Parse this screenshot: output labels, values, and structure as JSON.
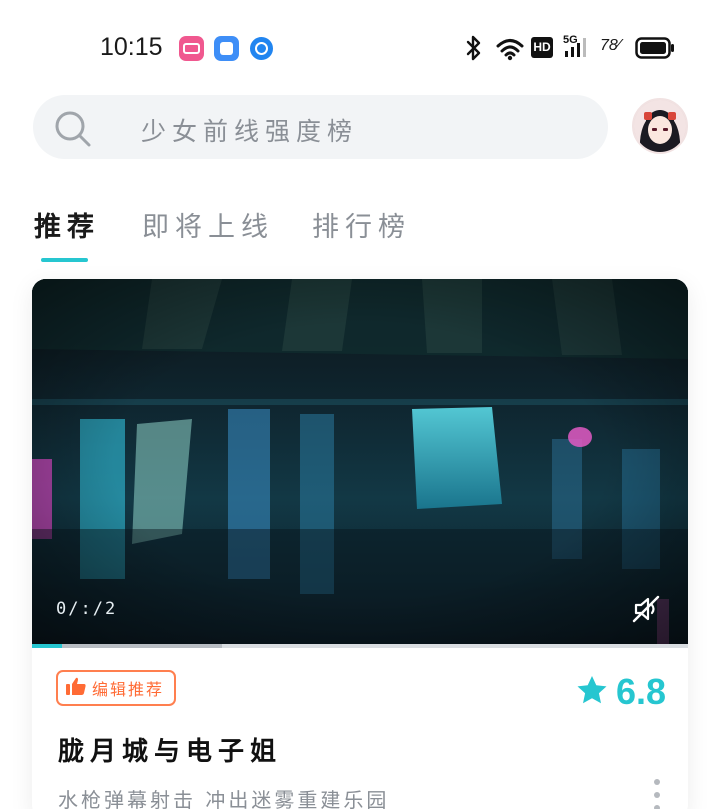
{
  "status_bar": {
    "time": "10:15",
    "notification_icons": [
      "bilibili-icon",
      "app-box-icon",
      "blue-dot-icon"
    ],
    "system_icons": [
      "bluetooth-icon",
      "wifi-icon",
      "hd-icon",
      "signal-5g-icon",
      "battery-icon"
    ],
    "hd_label": "HD",
    "network_label": "5G",
    "battery_percent": "78"
  },
  "search": {
    "placeholder": "少女前线强度榜",
    "icon": "search-icon"
  },
  "profile": {
    "avatar_icon": "avatar"
  },
  "tabs": [
    {
      "label": "推荐",
      "active": true
    },
    {
      "label": "即将上线",
      "active": false
    },
    {
      "label": "排行榜",
      "active": false
    }
  ],
  "card": {
    "video": {
      "time_display": "0/:/2",
      "mute_icon": "mute-icon",
      "progress": 0.045,
      "buffered": 0.29
    },
    "badge": {
      "icon": "thumbs-up-icon",
      "label": "编辑推荐"
    },
    "rating": {
      "icon": "star-icon",
      "value": "6.8"
    },
    "title": "胧月城与电子姐",
    "description": "水枪弹幕射击 冲出迷雾重建乐园"
  },
  "colors": {
    "accent": "#26c6d0",
    "badge": "#ff6b35",
    "muted_text": "#8a8f96"
  }
}
